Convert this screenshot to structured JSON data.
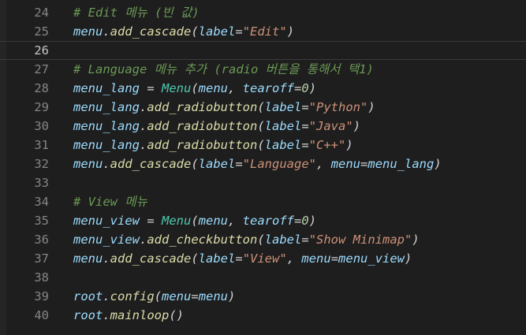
{
  "editor": {
    "lines": [
      {
        "n": "24",
        "tokens": [
          {
            "t": "comment",
            "v": "# Edit 메뉴 (빈 값)"
          }
        ]
      },
      {
        "n": "25",
        "tokens": [
          {
            "t": "var",
            "v": "menu"
          },
          {
            "t": "punct",
            "v": "."
          },
          {
            "t": "method",
            "v": "add_cascade"
          },
          {
            "t": "punct",
            "v": "("
          },
          {
            "t": "param",
            "v": "label"
          },
          {
            "t": "op",
            "v": "="
          },
          {
            "t": "string",
            "v": "\"Edit\""
          },
          {
            "t": "punct",
            "v": ")"
          }
        ]
      },
      {
        "n": "26",
        "current": true,
        "tokens": []
      },
      {
        "n": "27",
        "tokens": [
          {
            "t": "comment",
            "v": "# Language 메뉴 추가 (radio 버튼을 통해서 택1)"
          }
        ]
      },
      {
        "n": "28",
        "tokens": [
          {
            "t": "var",
            "v": "menu_lang"
          },
          {
            "t": "op",
            "v": " = "
          },
          {
            "t": "class",
            "v": "Menu"
          },
          {
            "t": "punct",
            "v": "("
          },
          {
            "t": "var",
            "v": "menu"
          },
          {
            "t": "punct",
            "v": ", "
          },
          {
            "t": "param",
            "v": "tearoff"
          },
          {
            "t": "op",
            "v": "="
          },
          {
            "t": "number",
            "v": "0"
          },
          {
            "t": "punct",
            "v": ")"
          }
        ]
      },
      {
        "n": "29",
        "tokens": [
          {
            "t": "var",
            "v": "menu_lang"
          },
          {
            "t": "punct",
            "v": "."
          },
          {
            "t": "method",
            "v": "add_radiobutton"
          },
          {
            "t": "punct",
            "v": "("
          },
          {
            "t": "param",
            "v": "label"
          },
          {
            "t": "op",
            "v": "="
          },
          {
            "t": "string",
            "v": "\"Python\""
          },
          {
            "t": "punct",
            "v": ")"
          }
        ]
      },
      {
        "n": "30",
        "tokens": [
          {
            "t": "var",
            "v": "menu_lang"
          },
          {
            "t": "punct",
            "v": "."
          },
          {
            "t": "method",
            "v": "add_radiobutton"
          },
          {
            "t": "punct",
            "v": "("
          },
          {
            "t": "param",
            "v": "label"
          },
          {
            "t": "op",
            "v": "="
          },
          {
            "t": "string",
            "v": "\"Java\""
          },
          {
            "t": "punct",
            "v": ")"
          }
        ]
      },
      {
        "n": "31",
        "tokens": [
          {
            "t": "var",
            "v": "menu_lang"
          },
          {
            "t": "punct",
            "v": "."
          },
          {
            "t": "method",
            "v": "add_radiobutton"
          },
          {
            "t": "punct",
            "v": "("
          },
          {
            "t": "param",
            "v": "label"
          },
          {
            "t": "op",
            "v": "="
          },
          {
            "t": "string",
            "v": "\"C++\""
          },
          {
            "t": "punct",
            "v": ")"
          }
        ]
      },
      {
        "n": "32",
        "tokens": [
          {
            "t": "var",
            "v": "menu"
          },
          {
            "t": "punct",
            "v": "."
          },
          {
            "t": "method",
            "v": "add_cascade"
          },
          {
            "t": "punct",
            "v": "("
          },
          {
            "t": "param",
            "v": "label"
          },
          {
            "t": "op",
            "v": "="
          },
          {
            "t": "string",
            "v": "\"Language\""
          },
          {
            "t": "punct",
            "v": ", "
          },
          {
            "t": "param",
            "v": "menu"
          },
          {
            "t": "op",
            "v": "="
          },
          {
            "t": "var",
            "v": "menu_lang"
          },
          {
            "t": "punct",
            "v": ")"
          }
        ]
      },
      {
        "n": "33",
        "tokens": []
      },
      {
        "n": "34",
        "tokens": [
          {
            "t": "comment",
            "v": "# View 메뉴"
          }
        ]
      },
      {
        "n": "35",
        "tokens": [
          {
            "t": "var",
            "v": "menu_view"
          },
          {
            "t": "op",
            "v": " = "
          },
          {
            "t": "class",
            "v": "Menu"
          },
          {
            "t": "punct",
            "v": "("
          },
          {
            "t": "var",
            "v": "menu"
          },
          {
            "t": "punct",
            "v": ", "
          },
          {
            "t": "param",
            "v": "tearoff"
          },
          {
            "t": "op",
            "v": "="
          },
          {
            "t": "number",
            "v": "0"
          },
          {
            "t": "punct",
            "v": ")"
          }
        ]
      },
      {
        "n": "36",
        "tokens": [
          {
            "t": "var",
            "v": "menu_view"
          },
          {
            "t": "punct",
            "v": "."
          },
          {
            "t": "method",
            "v": "add_checkbutton"
          },
          {
            "t": "punct",
            "v": "("
          },
          {
            "t": "param",
            "v": "label"
          },
          {
            "t": "op",
            "v": "="
          },
          {
            "t": "string",
            "v": "\"Show Minimap\""
          },
          {
            "t": "punct",
            "v": ")"
          }
        ]
      },
      {
        "n": "37",
        "tokens": [
          {
            "t": "var",
            "v": "menu"
          },
          {
            "t": "punct",
            "v": "."
          },
          {
            "t": "method",
            "v": "add_cascade"
          },
          {
            "t": "punct",
            "v": "("
          },
          {
            "t": "param",
            "v": "label"
          },
          {
            "t": "op",
            "v": "="
          },
          {
            "t": "string",
            "v": "\"View\""
          },
          {
            "t": "punct",
            "v": ", "
          },
          {
            "t": "param",
            "v": "menu"
          },
          {
            "t": "op",
            "v": "="
          },
          {
            "t": "var",
            "v": "menu_view"
          },
          {
            "t": "punct",
            "v": ")"
          }
        ]
      },
      {
        "n": "38",
        "tokens": []
      },
      {
        "n": "39",
        "tokens": [
          {
            "t": "var",
            "v": "root"
          },
          {
            "t": "punct",
            "v": "."
          },
          {
            "t": "method",
            "v": "config"
          },
          {
            "t": "punct",
            "v": "("
          },
          {
            "t": "param",
            "v": "menu"
          },
          {
            "t": "op",
            "v": "="
          },
          {
            "t": "var",
            "v": "menu"
          },
          {
            "t": "punct",
            "v": ")"
          }
        ]
      },
      {
        "n": "40",
        "tokens": [
          {
            "t": "var",
            "v": "root"
          },
          {
            "t": "punct",
            "v": "."
          },
          {
            "t": "method",
            "v": "mainloop"
          },
          {
            "t": "punct",
            "v": "()"
          }
        ]
      }
    ]
  },
  "colors": {
    "background": "#1e1e1e",
    "line_number": "#858585",
    "comment": "#6a9955",
    "variable": "#9cdcfe",
    "method": "#dcdcaa",
    "class": "#4ec9b0",
    "string": "#ce9178",
    "number": "#b5cea8"
  }
}
